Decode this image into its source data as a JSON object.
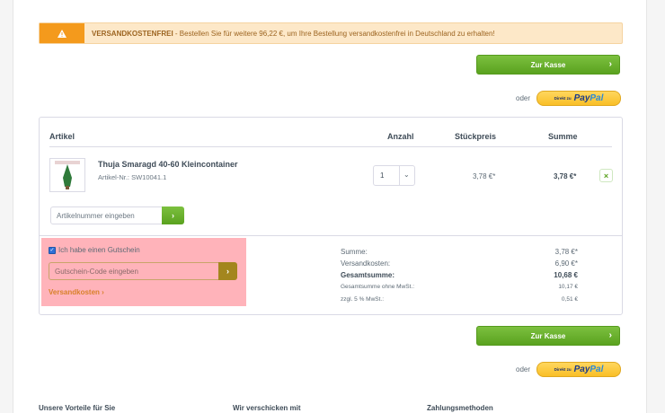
{
  "notice": {
    "strong": "VERSANDKOSTENFREI",
    "text": " - Bestellen Sie für weitere 96,22 €, um Ihre Bestellung versandkostenfrei in Deutschland zu erhalten!"
  },
  "checkout": {
    "label": "Zur Kasse",
    "or": "oder"
  },
  "paypal": {
    "prefix": "Direkt zu",
    "brand_a": "Pay",
    "brand_b": "Pal"
  },
  "cart": {
    "columns": {
      "article": "Artikel",
      "quantity": "Anzahl",
      "unit_price": "Stückpreis",
      "total": "Summe"
    },
    "item": {
      "name": "Thuja Smaragd 40-60 Kleincontainer",
      "sku": "Artikel-Nr.: SW10041.1",
      "quantity": "1",
      "unit_price": "3,78 €*",
      "total": "3,78 €*"
    },
    "article_number_placeholder": "Artikelnummer eingeben"
  },
  "voucher": {
    "checkbox_label": "Ich habe einen Gutschein",
    "placeholder": "Gutschein-Code eingeben",
    "shipping_link": "Versandkosten"
  },
  "summary": {
    "subtotal_label": "Summe:",
    "subtotal": "3,78 €*",
    "shipping_label": "Versandkosten:",
    "shipping": "6,90 €*",
    "grand_label": "Gesamtsumme:",
    "grand": "10,68 €",
    "net_label": "Gesamtsumme ohne MwSt.:",
    "net": "10,17 €",
    "vat_label": "zzgl. 5 % MwSt.:",
    "vat": "0,51 €"
  },
  "footer": {
    "col1": "Unsere Vorteile für Sie",
    "col2": "Wir verschicken mit",
    "col3": "Zahlungsmethoden"
  },
  "colors": {
    "accent_green": "#5aa21f",
    "warning_orange": "#f49a1c",
    "highlight_pink": "#ffb3ba"
  }
}
